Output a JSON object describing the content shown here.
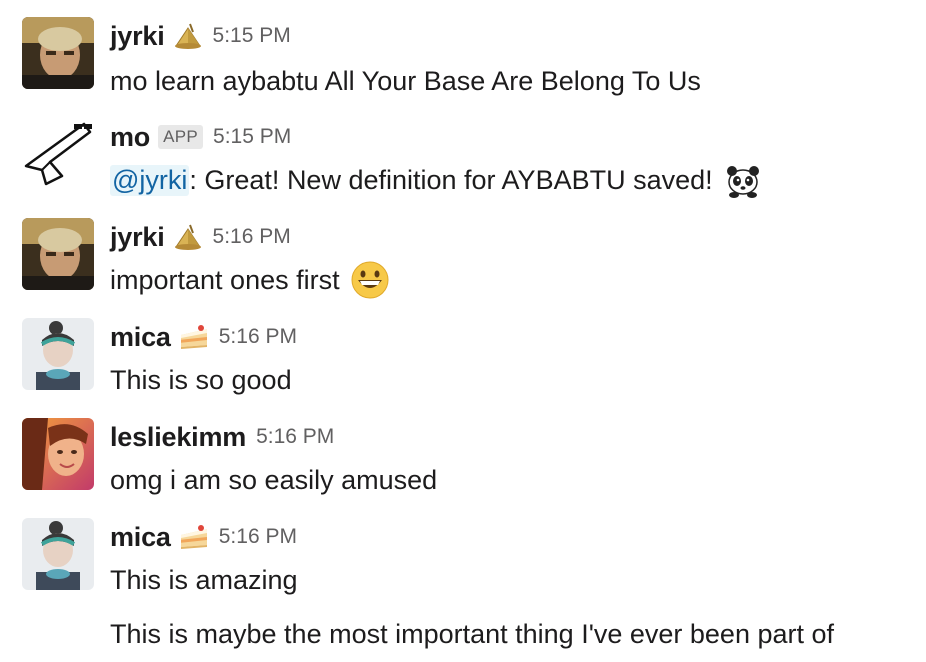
{
  "messages": [
    {
      "author": "jyrki",
      "status_icon": "pyramid-lamp-icon",
      "time": "5:15 PM",
      "text": "mo learn aybabtu All Your Base Are Belong To Us"
    },
    {
      "author": "mo",
      "badge": "APP",
      "time": "5:15 PM",
      "mention": "@jyrki",
      "text": ": Great! New definition for AYBABTU saved!",
      "emoji": "panda-icon"
    },
    {
      "author": "jyrki",
      "status_icon": "pyramid-lamp-icon",
      "time": "5:16 PM",
      "text": "important ones first",
      "emoji": "grinning-face-icon"
    },
    {
      "author": "mica",
      "status_icon": "cake-slice-icon",
      "time": "5:16 PM",
      "text": "This is so good"
    },
    {
      "author": "lesliekimm",
      "time": "5:16 PM",
      "text": "omg i am so easily amused"
    },
    {
      "author": "mica",
      "status_icon": "cake-slice-icon",
      "time": "5:16 PM",
      "text": "This is amazing",
      "followup": "This is maybe the most important thing I've ever been part of"
    }
  ],
  "colors": {
    "name": "#1d1c1d",
    "timestamp": "#616061",
    "mention_text": "#1264a3",
    "mention_bg": "#e8f5fa",
    "badge_bg": "#e8e8e8"
  }
}
